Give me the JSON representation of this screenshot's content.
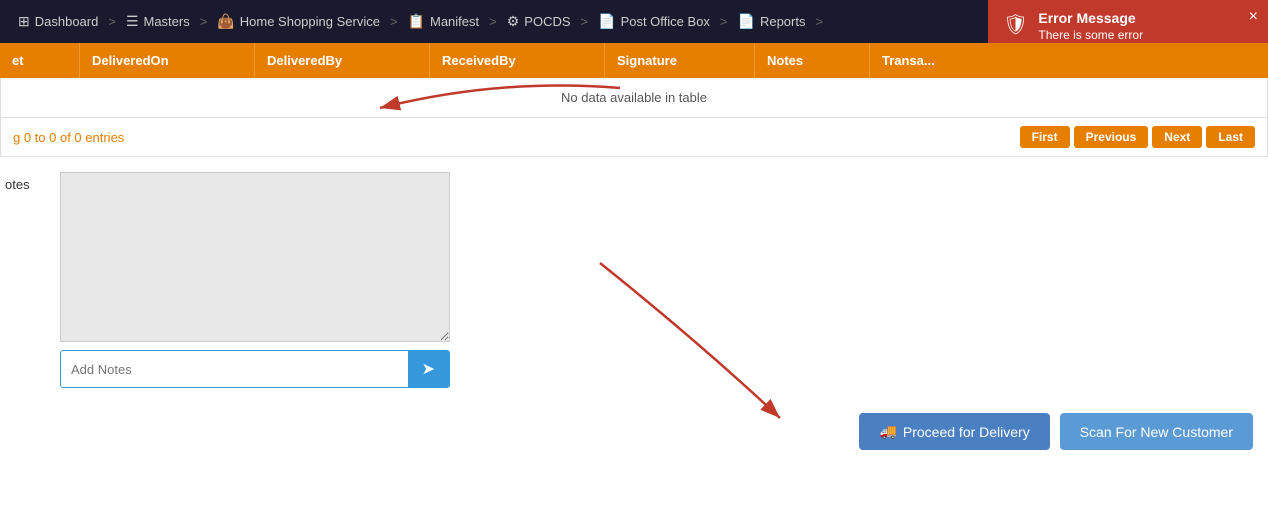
{
  "navbar": {
    "items": [
      {
        "id": "dashboard",
        "label": "Dashboard",
        "icon": "⊞"
      },
      {
        "id": "masters",
        "label": "Masters",
        "icon": "☰"
      },
      {
        "id": "home-shopping-service",
        "label": "Home Shopping Service",
        "icon": "👜"
      },
      {
        "id": "manifest",
        "label": "Manifest",
        "icon": "📋"
      },
      {
        "id": "pocds",
        "label": "POCDS",
        "icon": "⚙"
      },
      {
        "id": "post-office-box",
        "label": "Post Office Box",
        "icon": "📄"
      },
      {
        "id": "reports",
        "label": "Reports",
        "icon": "📄"
      }
    ]
  },
  "error": {
    "title": "Error Message",
    "message": "There is some error",
    "close_label": "×"
  },
  "table": {
    "columns": [
      "et",
      "DeliveredOn",
      "DeliveredBy",
      "ReceivedBy",
      "Signature",
      "Notes",
      "Transa"
    ],
    "empty_message": "No data available in table",
    "entries_info": "g 0 to 0 of 0 entries"
  },
  "pagination": {
    "first_label": "First",
    "previous_label": "Previous",
    "next_label": "Next",
    "last_label": "Last"
  },
  "notes_section": {
    "label": "otes",
    "textarea_placeholder": "",
    "input_placeholder": "Add Notes",
    "send_icon": "➤"
  },
  "actions": {
    "proceed_label": "Proceed for Delivery",
    "proceed_icon": "🚚",
    "scan_label": "Scan For New Customer"
  },
  "colors": {
    "orange": "#e67e00",
    "blue": "#3498db",
    "error_red": "#c0392b"
  }
}
